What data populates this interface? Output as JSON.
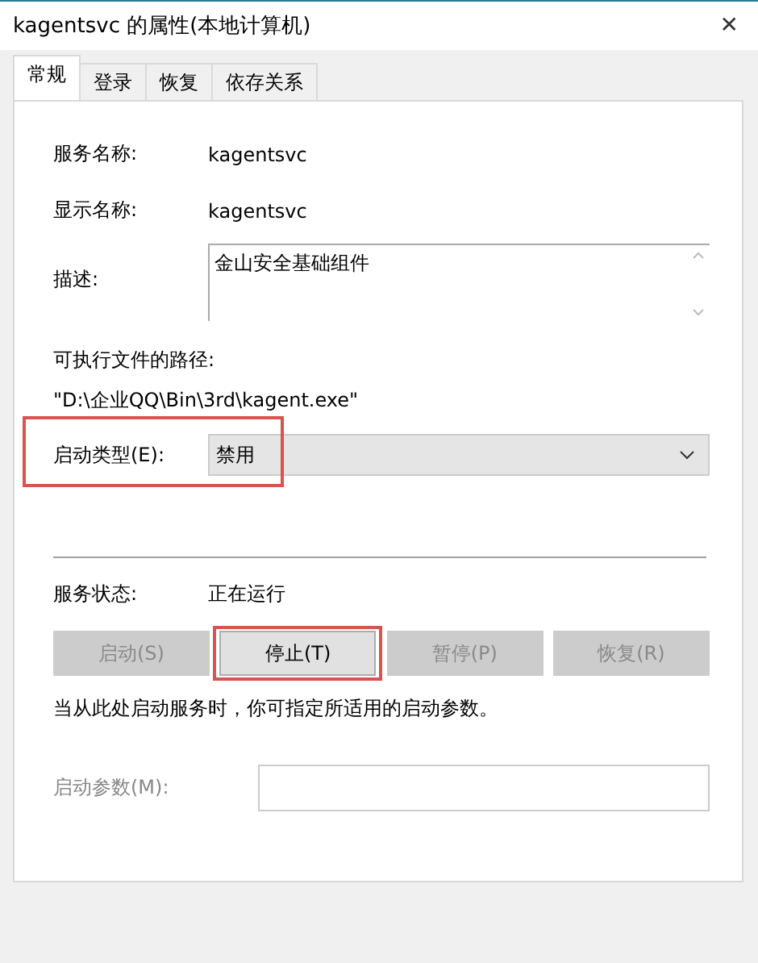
{
  "window": {
    "title": "kagentsvc 的属性(本地计算机)",
    "close": "✕"
  },
  "tabs": [
    {
      "label": "常规",
      "selected": true
    },
    {
      "label": "登录",
      "selected": false
    },
    {
      "label": "恢复",
      "selected": false
    },
    {
      "label": "依存关系",
      "selected": false
    }
  ],
  "service_name": {
    "label": "服务名称:",
    "value": "kagentsvc"
  },
  "display_name": {
    "label": "显示名称:",
    "value": "kagentsvc"
  },
  "description": {
    "label": "描述:",
    "value": "金山安全基础组件"
  },
  "executable_path": {
    "label": "可执行文件的路径:",
    "value": "\"D:\\企业QQ\\Bin\\3rd\\kagent.exe\""
  },
  "startup_type": {
    "label": "启动类型(E):",
    "value": "禁用",
    "highlighted": true
  },
  "service_status": {
    "label": "服务状态:",
    "value": "正在运行"
  },
  "buttons": [
    {
      "label": "启动(S)",
      "disabled": true,
      "highlighted": false
    },
    {
      "label": "停止(T)",
      "disabled": false,
      "highlighted": true
    },
    {
      "label": "暂停(P)",
      "disabled": true,
      "highlighted": false
    },
    {
      "label": "恢复(R)",
      "disabled": true,
      "highlighted": false
    }
  ],
  "hint": "当从此处启动服务时，你可指定所适用的启动参数。",
  "start_parameters": {
    "label": "启动参数(M):",
    "disabled": true
  }
}
